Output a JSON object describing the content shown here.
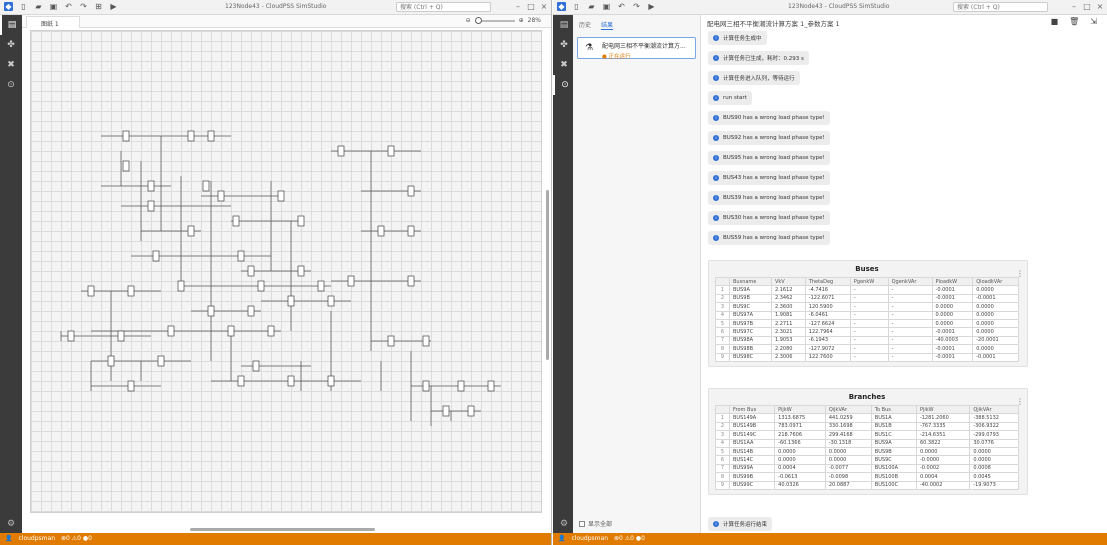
{
  "left_window": {
    "title": "123Node43 - CloudPSS SimStudio",
    "search_placeholder": "搜索 (Ctrl + Q)",
    "tab_label": "图纸 1",
    "zoom_label": "28%",
    "status_user": "cloudpsman",
    "status_counts": "⊗0 ⚠0 ●0"
  },
  "right_window": {
    "title": "123Node43 - CloudPSS SimStudio",
    "search_placeholder": "搜索 (Ctrl + Q)",
    "status_user": "cloudpsman",
    "panel_tabs": [
      "历史",
      "结果"
    ],
    "job_name": "配电网三相不平衡潮流计算方...",
    "job_status": "● 正在运行",
    "show_all_label": "显示全部",
    "main_title": "配电网三相不平衡潮流计算方案 1_参数方案 1",
    "messages": [
      "计算任务生成中",
      "计算任务已生成，耗时：0.293 s",
      "计算任务进入队列，等待运行",
      "run start",
      "BUS90 has a wrong load phase type!",
      "BUS92 has a wrong load phase type!",
      "BUS95 has a wrong load phase type!",
      "BUS43 has a wrong load phase type!",
      "BUS39 has a wrong load phase type!",
      "BUS30 has a wrong load phase type!",
      "BUS59 has a wrong load phase type!"
    ],
    "last_message": "计算任务运行结束",
    "buses": {
      "title": "Buses",
      "headers": [
        "",
        "Busname",
        "VkV",
        "ThetaDeg",
        "PgenkW",
        "QgenkVAr",
        "PloadkW",
        "QloadkVAr"
      ],
      "rows": [
        [
          "1",
          "BUS9A",
          "2.1612",
          "-4.7416",
          "-",
          "-",
          "-0.0001",
          "0.0000"
        ],
        [
          "2",
          "BUS9B",
          "2.3462",
          "-122.6071",
          "-",
          "-",
          "-0.0001",
          "-0.0001"
        ],
        [
          "3",
          "BUS9C",
          "2.3600",
          "120.5900",
          "-",
          "-",
          "0.0000",
          "0.0000"
        ],
        [
          "4",
          "BUS97A",
          "1.9081",
          "-6.0461",
          "-",
          "-",
          "0.0000",
          "0.0000"
        ],
        [
          "5",
          "BUS97B",
          "2.2711",
          "-127.6624",
          "-",
          "-",
          "0.0000",
          "0.0000"
        ],
        [
          "6",
          "BUS97C",
          "2.3021",
          "122.7964",
          "-",
          "-",
          "-0.0001",
          "0.0000"
        ],
        [
          "7",
          "BUS98A",
          "1.9053",
          "-6.1943",
          "-",
          "-",
          "-40.0003",
          "-20.0001"
        ],
        [
          "8",
          "BUS98B",
          "2.2080",
          "-127.9072",
          "-",
          "-",
          "-0.0001",
          "0.0000"
        ],
        [
          "9",
          "BUS98C",
          "2.3006",
          "122.7600",
          "-",
          "-",
          "-0.0001",
          "-0.0001"
        ]
      ]
    },
    "branches": {
      "title": "Branches",
      "headers": [
        "",
        "From Bus",
        "PijkW",
        "QijkVAr",
        "To Bus",
        "PjikW",
        "QjikVAr"
      ],
      "rows": [
        [
          "1",
          "BUS149A",
          "1313.6875",
          "441.0259",
          "BUS1A",
          "-1281.2060",
          "-388.5132"
        ],
        [
          "2",
          "BUS149B",
          "783.0971",
          "330.1698",
          "BUS1B",
          "-767.3335",
          "-306.9322"
        ],
        [
          "3",
          "BUS149C",
          "218.7606",
          "299.4168",
          "BUS1C",
          "-214.6351",
          "-299.0793"
        ],
        [
          "4",
          "BUS1AA",
          "-60.1366",
          "-30.1318",
          "BUS9A",
          "60.3822",
          "30.0776"
        ],
        [
          "5",
          "BUS14B",
          "0.0000",
          "0.0000",
          "BUS9B",
          "0.0000",
          "0.0000"
        ],
        [
          "6",
          "BUS14C",
          "0.0000",
          "0.0000",
          "BUS9C",
          "-0.0000",
          "0.0000"
        ],
        [
          "7",
          "BUS99A",
          "0.0004",
          "-0.0077",
          "BUS100A",
          "-0.0002",
          "0.0008"
        ],
        [
          "8",
          "BUS99B",
          "-0.0613",
          "-0.0098",
          "BUS100B",
          "0.0004",
          "0.0045"
        ],
        [
          "9",
          "BUS99C",
          "40.0326",
          "20.0887",
          "BUS100C",
          "-40.0002",
          "-19.9073"
        ]
      ]
    }
  }
}
